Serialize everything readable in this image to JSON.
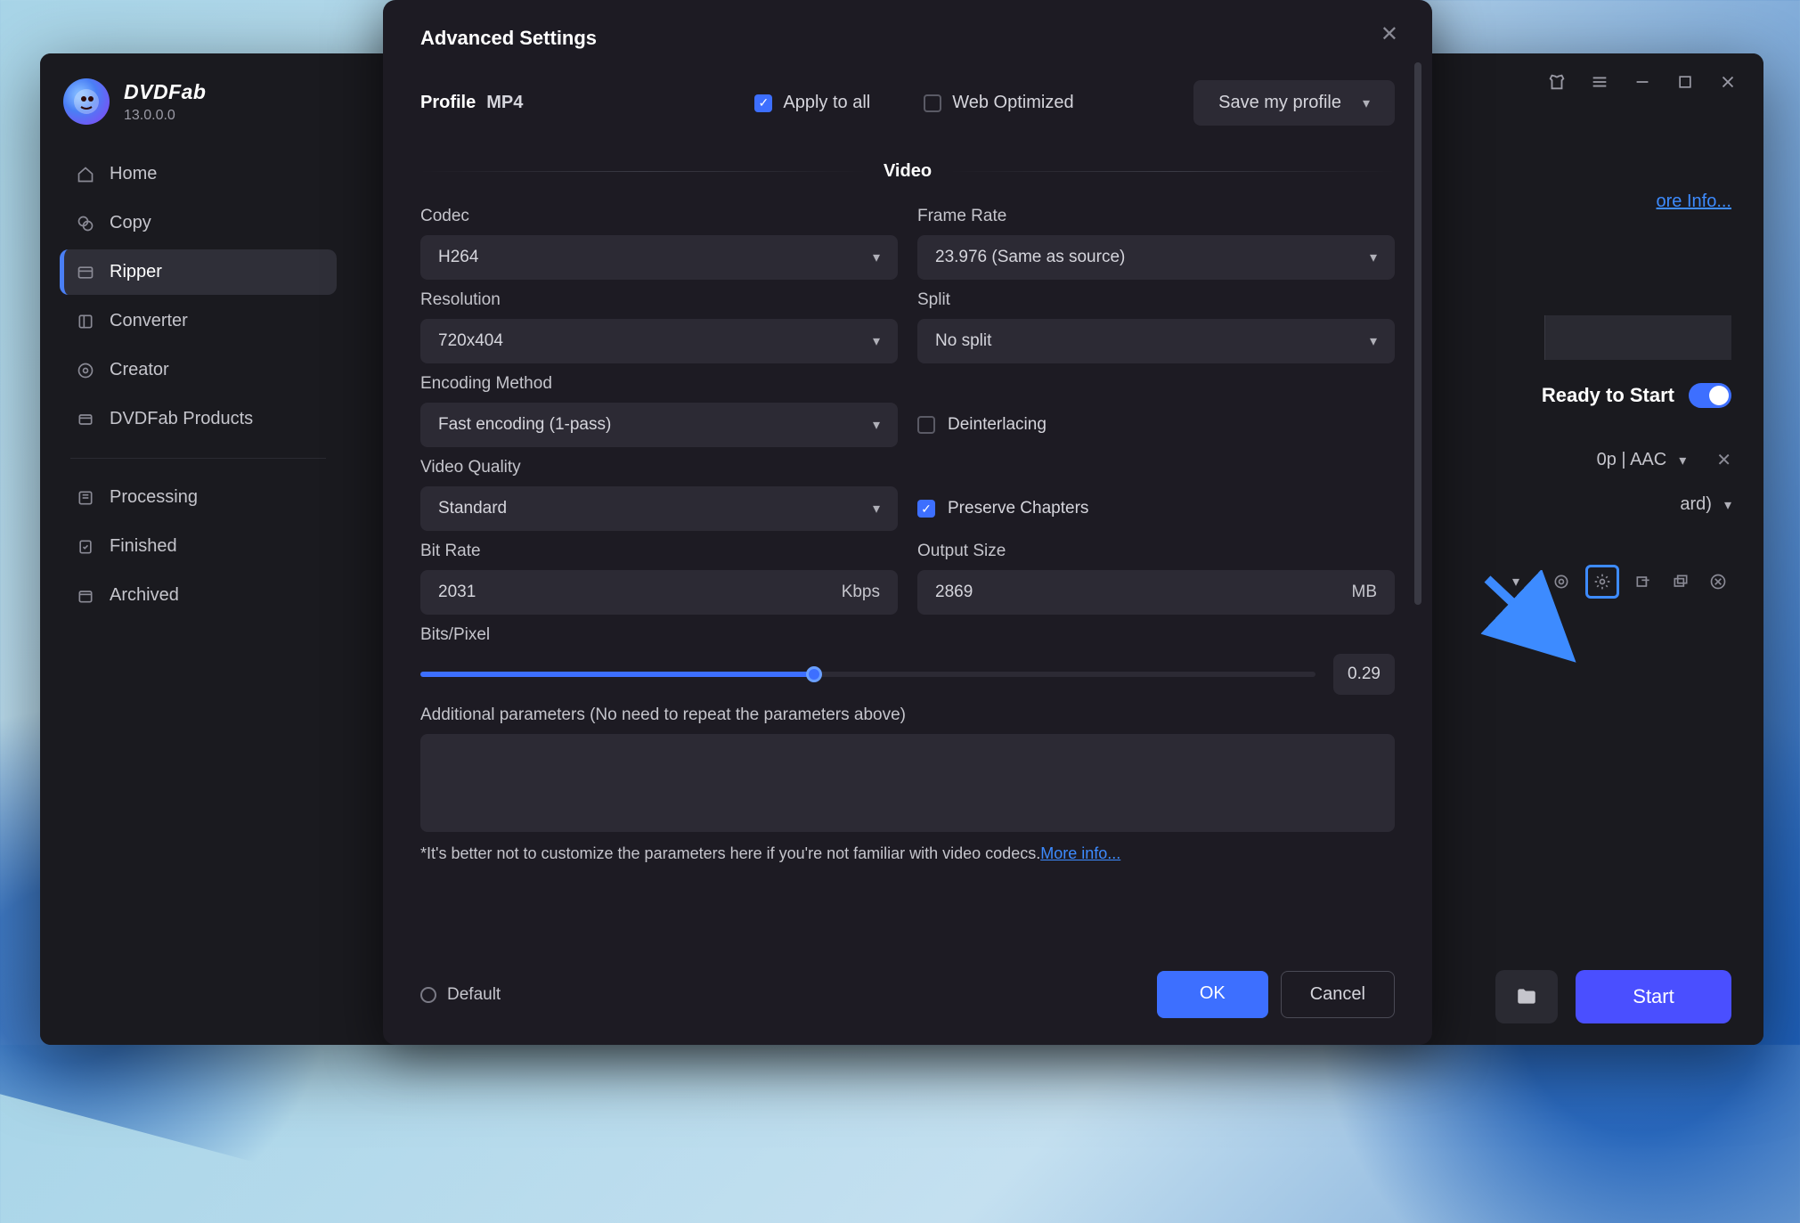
{
  "app": {
    "name": "DVDFab",
    "version": "13.0.0.0"
  },
  "sidebar": {
    "items": [
      {
        "label": "Home",
        "icon": "home"
      },
      {
        "label": "Copy",
        "icon": "copy"
      },
      {
        "label": "Ripper",
        "icon": "ripper",
        "active": true
      },
      {
        "label": "Converter",
        "icon": "converter"
      },
      {
        "label": "Creator",
        "icon": "creator"
      },
      {
        "label": "DVDFab Products",
        "icon": "products"
      }
    ],
    "secondary": [
      {
        "label": "Processing",
        "icon": "processing"
      },
      {
        "label": "Finished",
        "icon": "finished"
      },
      {
        "label": "Archived",
        "icon": "archived"
      }
    ]
  },
  "main": {
    "more_info": "ore Info...",
    "ready_label": "Ready to Start",
    "ready_toggle": true,
    "meta_codec": "0p | AAC",
    "meta_audio": "ard)",
    "start_label": "Start"
  },
  "modal": {
    "title": "Advanced Settings",
    "profile_label": "Profile",
    "profile_value": "MP4",
    "apply_all_label": "Apply to all",
    "apply_all_checked": true,
    "web_opt_label": "Web Optimized",
    "web_opt_checked": false,
    "save_profile_label": "Save my profile",
    "section_video": "Video",
    "fields": {
      "codec_label": "Codec",
      "codec_value": "H264",
      "frame_rate_label": "Frame Rate",
      "frame_rate_value": "23.976 (Same as source)",
      "resolution_label": "Resolution",
      "resolution_value": "720x404",
      "split_label": "Split",
      "split_value": "No split",
      "encoding_label": "Encoding Method",
      "encoding_value": "Fast encoding (1-pass)",
      "deinterlacing_label": "Deinterlacing",
      "deinterlacing_checked": false,
      "quality_label": "Video Quality",
      "quality_value": "Standard",
      "preserve_label": "Preserve Chapters",
      "preserve_checked": true,
      "bitrate_label": "Bit Rate",
      "bitrate_value": "2031",
      "bitrate_unit": "Kbps",
      "output_label": "Output Size",
      "output_value": "2869",
      "output_unit": "MB",
      "bpp_label": "Bits/Pixel",
      "bpp_value": "0.29",
      "addl_label": "Additional parameters (No need to repeat the parameters above)",
      "footnote_text": "*It's better not to customize the parameters here if you're not familiar with video codecs.",
      "footnote_link": "More info..."
    },
    "footer": {
      "default_label": "Default",
      "ok_label": "OK",
      "cancel_label": "Cancel"
    }
  }
}
